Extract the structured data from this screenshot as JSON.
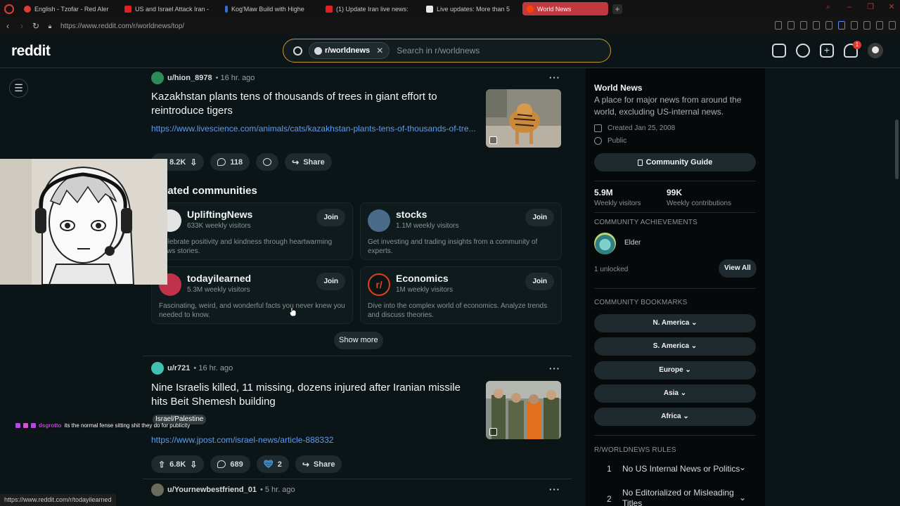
{
  "browser": {
    "tabs": [
      {
        "label": "English - Tzofar - Red Aler",
        "color": "#e03a3a"
      },
      {
        "label": "US and Israel Attack Iran -",
        "color": "#e02020"
      },
      {
        "label": "Kog'Maw Build with Highe",
        "color": "#2f6fd6"
      },
      {
        "label": "(1) Update Iran live news:",
        "color": "#e8e8e8"
      },
      {
        "label": "Live updates: More than 5",
        "color": "#e8e8e8"
      },
      {
        "label": "World News",
        "color": "#ff4500"
      }
    ],
    "new_tab": "+",
    "url": "https://www.reddit.com/r/worldnews/top/",
    "status_url": "https://www.reddit.com/r/todayilearned"
  },
  "header": {
    "logo": "reddit",
    "search_chip": "r/worldnews",
    "search_placeholder": "Search in r/worldnews",
    "notification_count": "1"
  },
  "posts": [
    {
      "user": "u/hion_8978",
      "age": "• 16 hr. ago",
      "title": "Kazakhstan plants tens of thousands of trees in giant effort to reintroduce tigers",
      "link": "https://www.livescience.com/animals/cats/kazakhstan-plants-tens-of-thousands-of-tre...",
      "votes": "8.2K",
      "comments": "118",
      "share": "Share"
    },
    {
      "user": "u/r721",
      "age": "• 16 hr. ago",
      "title": "Nine Israelis killed, 11 missing, dozens injured after Iranian missile hits Beit Shemesh building",
      "flair": "Israel/Palestine",
      "link": "https://www.jpost.com/israel-news/article-888332",
      "votes": "6.8K",
      "comments": "689",
      "awards": "2",
      "share": "Share"
    },
    {
      "user": "u/Yournewbestfriend_01",
      "age": "• 5 hr. ago"
    }
  ],
  "related": {
    "title": "Related communities",
    "show_more": "Show more",
    "communities": [
      {
        "name": "UpliftingNews",
        "visitors": "633K weekly visitors",
        "desc": "Celebrate positivity and kindness through heartwarming news stories.",
        "join": "Join"
      },
      {
        "name": "stocks",
        "visitors": "1.1M weekly visitors",
        "desc": "Get investing and trading insights from a community of experts.",
        "join": "Join"
      },
      {
        "name": "todayilearned",
        "visitors": "5.3M weekly visitors",
        "desc": "Fascinating, weird, and wonderful facts you never knew you needed to know.",
        "join": "Join"
      },
      {
        "name": "Economics",
        "visitors": "1M weekly visitors",
        "desc": "Dive into the complex world of economics. Analyze trends and discuss theories.",
        "join": "Join"
      }
    ]
  },
  "sidebar": {
    "title": "World News",
    "description": "A place for major news from around the world, excluding US-internal news.",
    "created": "Created Jan 25, 2008",
    "visibility": "Public",
    "guide_button": "Community Guide",
    "weekly_visitors": "5.9M",
    "weekly_visitors_label": "Weekly visitors",
    "weekly_contrib": "99K",
    "weekly_contrib_label": "Weekly contributions",
    "achievements_heading": "COMMUNITY ACHIEVEMENTS",
    "achievement_name": "Elder",
    "unlocked": "1 unlocked",
    "view_all": "View All",
    "bookmarks_heading": "COMMUNITY BOOKMARKS",
    "bookmarks": [
      "N. America",
      "S. America",
      "Europe",
      "Asia",
      "Africa"
    ],
    "rules_heading": "R/WORLDNEWS RULES",
    "rules": [
      {
        "num": "1",
        "text": "No US Internal News or Politics"
      },
      {
        "num": "2",
        "text": "No Editorialized or Misleading Titles"
      }
    ]
  },
  "chat": {
    "user": "dsgrotto",
    "message": "its the normal fense sitting shit they do for publicity"
  }
}
